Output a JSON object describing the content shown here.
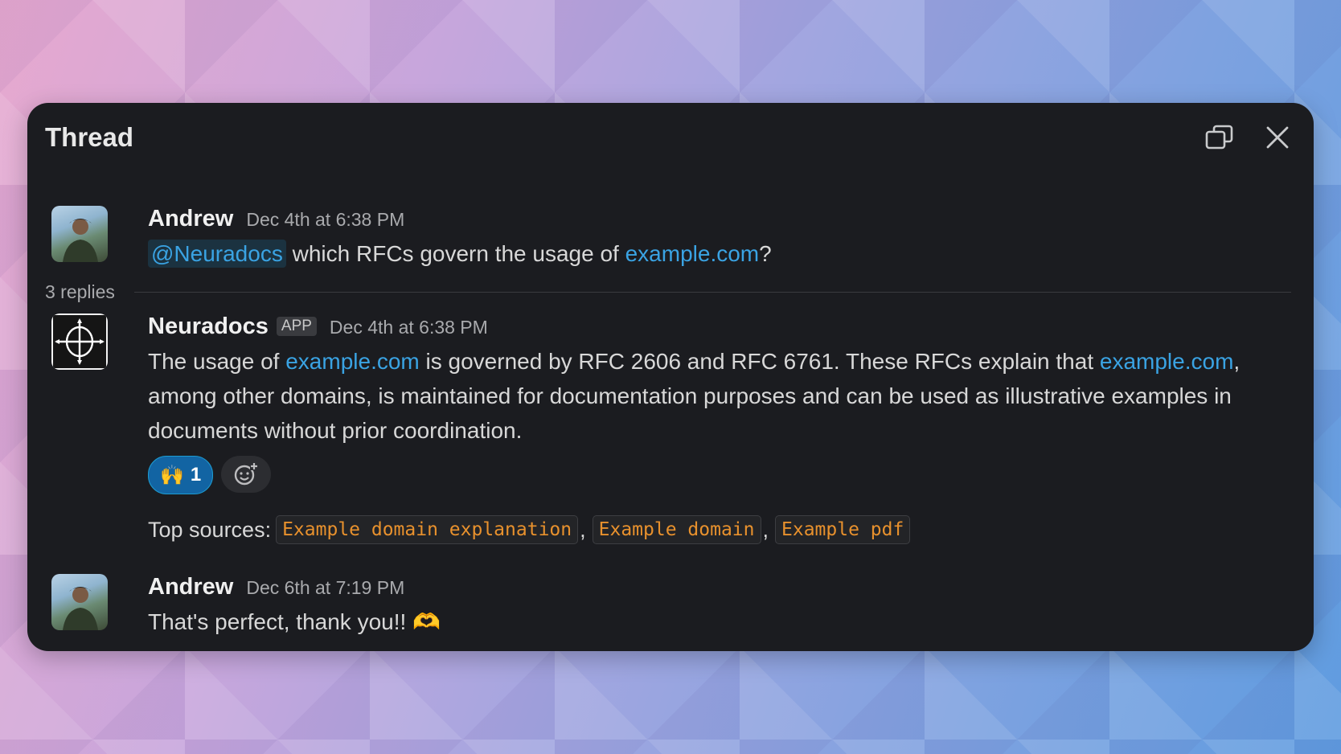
{
  "thread": {
    "title": "Thread",
    "open_in_window_icon": "open-in-new-window-icon",
    "close_icon": "close-icon",
    "replies_label": "3 replies"
  },
  "messages": [
    {
      "author": "Andrew",
      "timestamp": "Dec 4th at 6:38 PM",
      "mention": "@Neuradocs",
      "text_before_link": " which RFCs govern the usage of ",
      "link": "example.com",
      "text_after_link": "?"
    },
    {
      "author": "Neuradocs",
      "badge": "APP",
      "timestamp": "Dec 4th at 6:38 PM",
      "text_1": "The usage of ",
      "link_1": "example.com",
      "text_2": " is governed by RFC 2606 and RFC 6761. These RFCs explain that ",
      "link_2": "example.com",
      "text_3": ", among other domains, is maintained for documentation purposes and can be used as illustrative examples in documents without prior coordination.",
      "reaction_emoji": "🙌",
      "reaction_count": "1",
      "add_reaction_icon": "add-reaction-icon",
      "sources_label": "Top sources:",
      "sources": [
        "Example domain explanation",
        "Example domain",
        "Example pdf"
      ]
    },
    {
      "author": "Andrew",
      "timestamp": "Dec 6th at 7:19 PM",
      "text": "That's perfect, thank you!! 🫶"
    }
  ],
  "colors": {
    "panel": "#1b1c20",
    "link": "#3aa3e3",
    "reaction_bg": "#1264a3",
    "code": "#e8912d"
  }
}
